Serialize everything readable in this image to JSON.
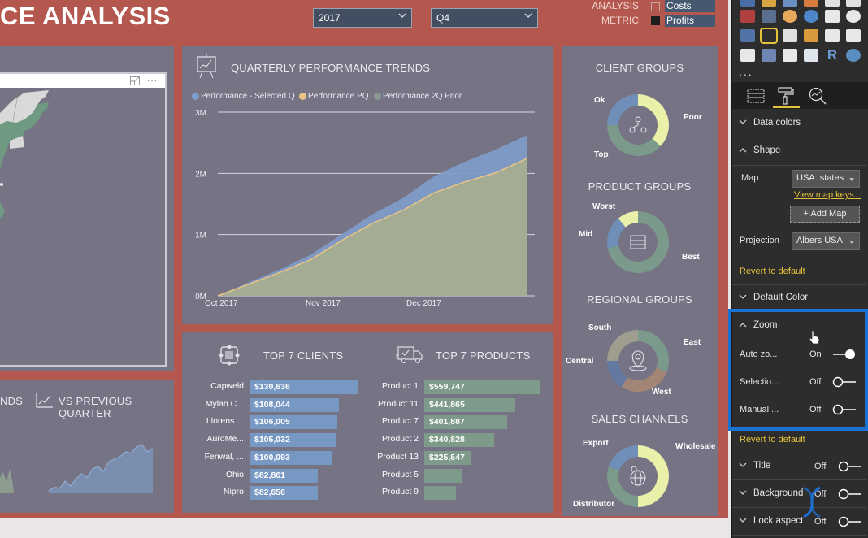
{
  "report": {
    "title": "CE ANALYSIS",
    "slicers": {
      "year": "2017",
      "quarter": "Q4"
    },
    "analysis_metric": {
      "label_line1": "ANALYSIS",
      "label_line2": "METRIC",
      "options": [
        {
          "label": "Costs",
          "selected": false
        },
        {
          "label": "Profits",
          "selected": true
        }
      ]
    }
  },
  "map_visual": {
    "focus_mode_icon": "focus-mode-icon",
    "more_options": "..."
  },
  "trends": {
    "title": "QUARTERLY PERFORMANCE TRENDS",
    "partial_left_title": "NDS",
    "vs_title": "VS PREVIOUS QUARTER"
  },
  "chart_data": [
    {
      "type": "area",
      "title": "QUARTERLY PERFORMANCE TRENDS",
      "xlabel": "",
      "ylabel": "",
      "ylim": [
        0,
        3000000
      ],
      "y_ticks": [
        "0M",
        "1M",
        "2M",
        "3M"
      ],
      "x_ticks": [
        "Oct 2017",
        "Nov 2017",
        "Dec 2017"
      ],
      "legend": [
        "Performance - Selected Q",
        "Performance PQ",
        "Performance 2Q Prior"
      ],
      "legend_position": "top-left",
      "grid": true,
      "x": [
        0,
        0.1,
        0.2,
        0.3,
        0.4,
        0.5,
        0.6,
        0.7,
        0.8,
        0.9,
        1.0
      ],
      "series": [
        {
          "name": "Performance - Selected Q",
          "color": "#7f9bc8",
          "values": [
            0,
            210000,
            440000,
            700000,
            980000,
            1330000,
            1620000,
            1920000,
            2180000,
            2400000,
            2620000
          ]
        },
        {
          "name": "Performance PQ",
          "color": "#e9c586",
          "values": [
            0,
            180000,
            390000,
            620000,
            880000,
            1180000,
            1420000,
            1650000,
            1850000,
            2020000,
            2240000
          ]
        },
        {
          "name": "Performance 2Q Prior",
          "color": "#9aa896",
          "values": [
            0,
            175000,
            385000,
            610000,
            870000,
            1170000,
            1410000,
            1640000,
            1840000,
            2010000,
            2230000
          ]
        }
      ]
    },
    {
      "type": "bar",
      "title": "TOP 7 CLIENTS",
      "categories": [
        "Capweld",
        "Mylan C...",
        "Llorens ...",
        "AuroMe...",
        "Fenwal, ...",
        "Ohio",
        "Nipro"
      ],
      "values": [
        130636,
        108044,
        106005,
        105032,
        100093,
        82861,
        82656
      ],
      "value_labels": [
        "$130,636",
        "$108,044",
        "$106,005",
        "$105,032",
        "$100,093",
        "$82,861",
        "$82,656"
      ],
      "color": "#7898c4"
    },
    {
      "type": "bar",
      "title": "TOP 7 PRODUCTS",
      "categories": [
        "Product 1",
        "Product 11",
        "Product 7",
        "Product 2",
        "Product 13",
        "Product 5",
        "Product 9"
      ],
      "values": [
        559747,
        441865,
        401887,
        340828,
        225547,
        180000,
        155000
      ],
      "value_labels": [
        "$559,747",
        "$441,865",
        "$401,887",
        "$340,828",
        "$225,547",
        "",
        ""
      ],
      "color": "#7e9a8a"
    },
    {
      "type": "pie",
      "title": "CLIENT GROUPS",
      "categories": [
        "Poor",
        "Top",
        "Ok"
      ],
      "values": [
        37,
        38,
        25
      ],
      "colors": [
        "#eaefa9",
        "#7c9a8b",
        "#6f8fb8"
      ]
    },
    {
      "type": "pie",
      "title": "PRODUCT GROUPS",
      "categories": [
        "Best",
        "Mid",
        "Worst"
      ],
      "values": [
        72,
        17,
        11
      ],
      "colors": [
        "#7c9a8b",
        "#6f8fb8",
        "#eaefa9"
      ]
    },
    {
      "type": "pie",
      "title": "REGIONAL GROUPS",
      "categories": [
        "East",
        "West",
        "Central",
        "South"
      ],
      "values": [
        31,
        28,
        16,
        25
      ],
      "colors": [
        "#7c9a8b",
        "#a38575",
        "#6479a0",
        "#9e9d8e"
      ]
    },
    {
      "type": "pie",
      "title": "SALES CHANNELS",
      "categories": [
        "Wholesale",
        "Distributor",
        "Export"
      ],
      "values": [
        50,
        30,
        20
      ],
      "colors": [
        "#eaefa9",
        "#7c9a8b",
        "#6f8fb8"
      ]
    },
    {
      "type": "area",
      "title": "VS PREVIOUS QUARTER",
      "x": [
        0,
        1,
        2,
        3,
        4,
        5,
        6,
        7,
        8,
        9,
        10,
        11,
        12,
        13,
        14,
        15,
        16,
        17,
        18,
        19
      ],
      "series": [
        {
          "name": "vs previous quarter",
          "color": "#7e97bd",
          "values": [
            2,
            5,
            4,
            10,
            6,
            12,
            16,
            13,
            20,
            22,
            18,
            26,
            28,
            30,
            34,
            33,
            38,
            40,
            34,
            37
          ]
        }
      ]
    }
  ],
  "pane": {
    "viz_more": "...",
    "tabs": [
      "fields-tab",
      "format-tab",
      "analytics-tab"
    ],
    "sections": {
      "data_colors": "Data colors",
      "shape": "Shape",
      "map_label": "Map",
      "map_value": "USA: states",
      "view_map_keys": "View map keys...",
      "add_map": "+ Add Map",
      "projection_label": "Projection",
      "projection_value": "Albers USA",
      "revert1": "Revert to default",
      "default_color": "Default Color",
      "zoom": "Zoom",
      "auto_zoom": "Auto zo...",
      "auto_zoom_val": "On",
      "selection": "Selectio...",
      "selection_val": "Off",
      "manual": "Manual ...",
      "manual_val": "Off",
      "revert2": "Revert to default",
      "title": "Title",
      "title_val": "Off",
      "background": "Background",
      "background_val": "Off",
      "lock_aspect": "Lock aspect",
      "lock_aspect_val": "Off"
    }
  }
}
